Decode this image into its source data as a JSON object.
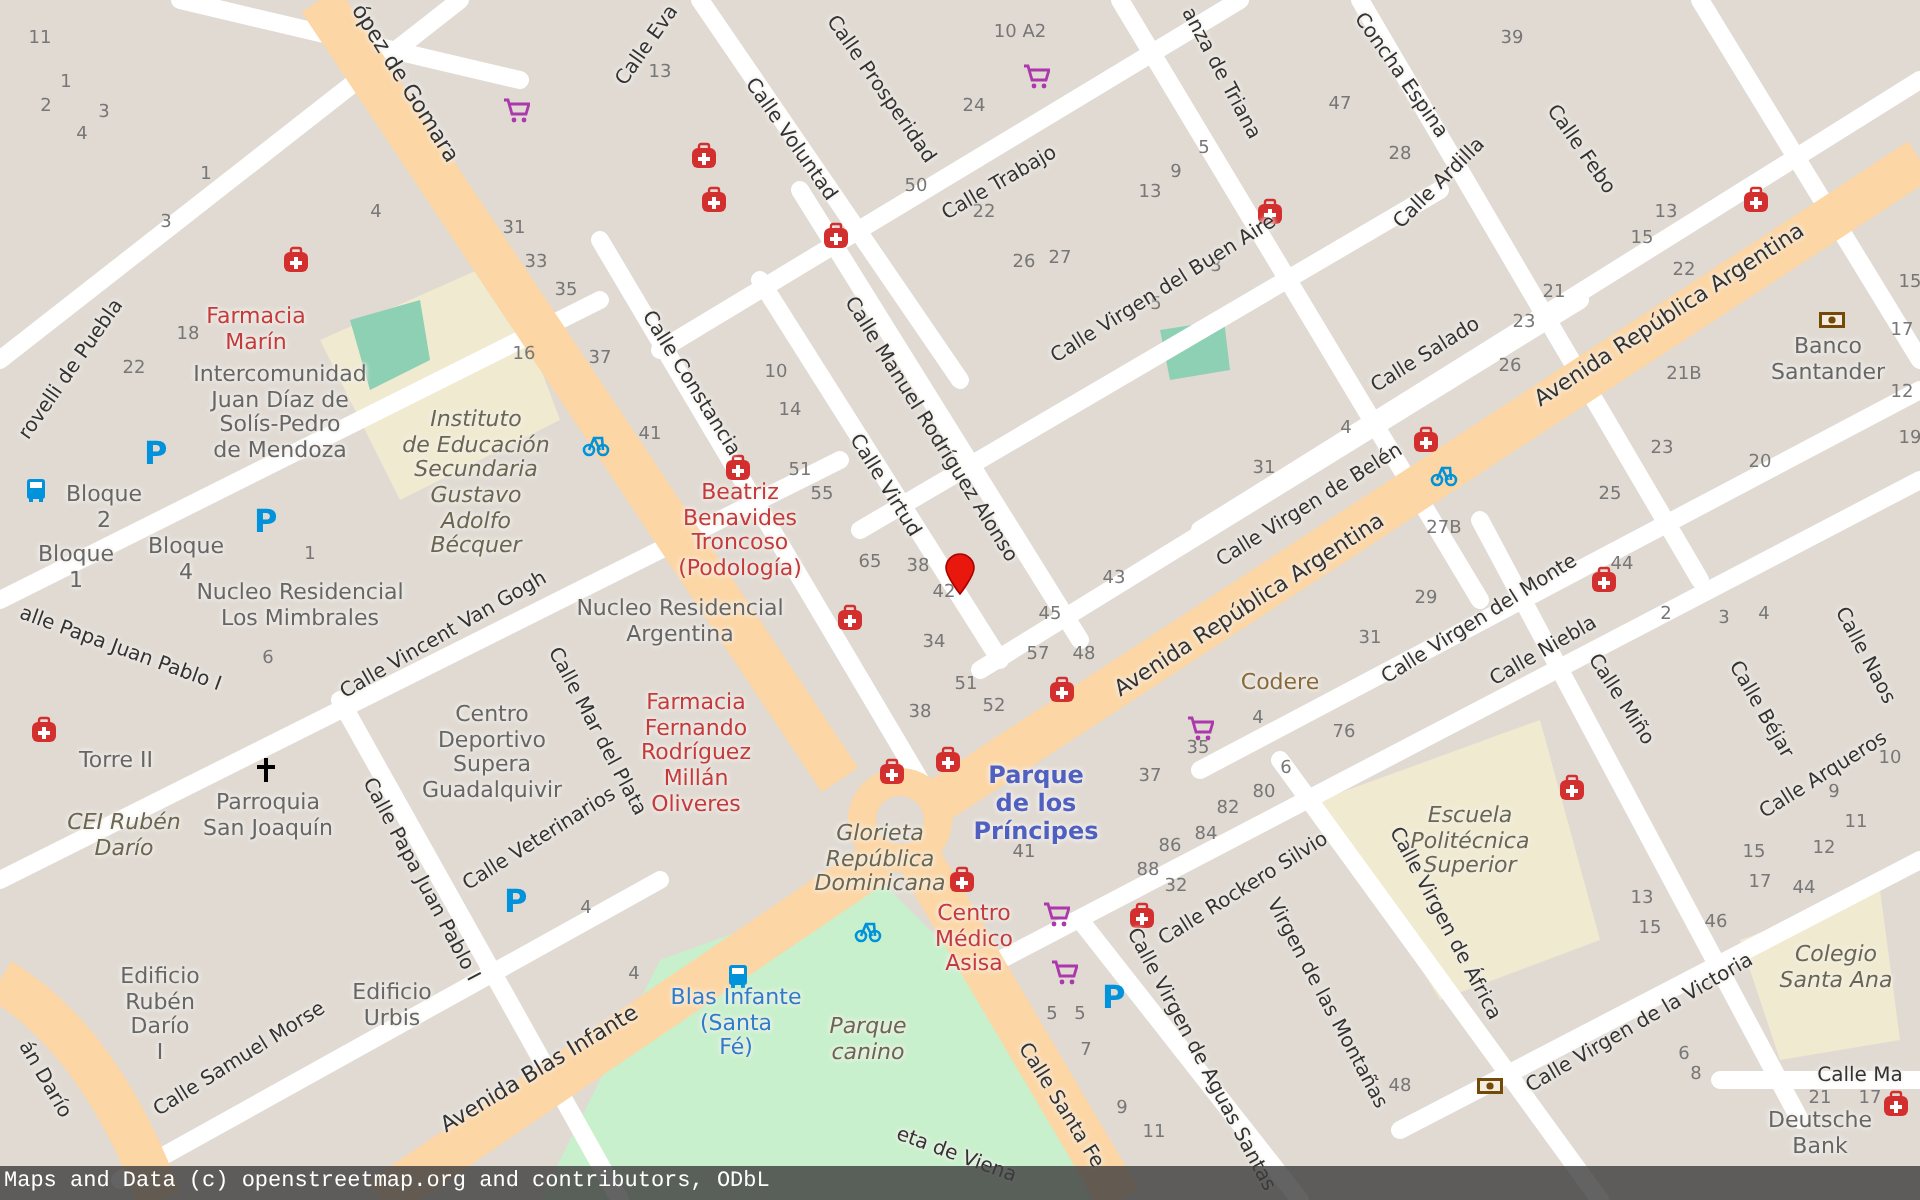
{
  "map": {
    "labels": [
      {
        "kind": "avenue",
        "lines": [
          "ópez de Gomara"
        ]
      },
      {
        "kind": "avenue",
        "lines": [
          "Avenida República Argentina"
        ]
      },
      {
        "kind": "avenue",
        "lines": [
          "Avenida República Argentina"
        ]
      },
      {
        "kind": "avenue",
        "lines": [
          "Avenida Blas Infante"
        ]
      },
      {
        "kind": "street",
        "lines": [
          "Calle Eva"
        ]
      },
      {
        "kind": "street",
        "lines": [
          "Calle Prosperidad"
        ]
      },
      {
        "kind": "street",
        "lines": [
          "Calle Voluntad"
        ]
      },
      {
        "kind": "street",
        "lines": [
          "Calle Trabajo"
        ]
      },
      {
        "kind": "street",
        "lines": [
          "anza de Triana"
        ]
      },
      {
        "kind": "street",
        "lines": [
          "Concha Espina"
        ]
      },
      {
        "kind": "street",
        "lines": [
          "Calle Ardilla"
        ]
      },
      {
        "kind": "street",
        "lines": [
          "Calle Febo"
        ]
      },
      {
        "kind": "street",
        "lines": [
          "Calle Virgen del Buen Aire"
        ]
      },
      {
        "kind": "street",
        "lines": [
          "Calle Salado"
        ]
      },
      {
        "kind": "street",
        "lines": [
          "Calle Manuel Rodríguez Alonso"
        ]
      },
      {
        "kind": "street",
        "lines": [
          "Calle Virtud"
        ]
      },
      {
        "kind": "street",
        "lines": [
          "Calle Constancia"
        ]
      },
      {
        "kind": "street",
        "lines": [
          "Calle Virgen de Belén"
        ]
      },
      {
        "kind": "street",
        "lines": [
          "rovelli de Puebla"
        ]
      },
      {
        "kind": "street",
        "lines": [
          "alle Papa Juan Pablo I"
        ]
      },
      {
        "kind": "street",
        "lines": [
          "Calle Vincent Van Gogh"
        ]
      },
      {
        "kind": "street",
        "lines": [
          "Calle Mar del Plata"
        ]
      },
      {
        "kind": "street",
        "lines": [
          "Calle Veterinarios"
        ]
      },
      {
        "kind": "street",
        "lines": [
          "Calle Papa Juan Pablo I"
        ]
      },
      {
        "kind": "street",
        "lines": [
          "Calle Samuel Morse"
        ]
      },
      {
        "kind": "street",
        "lines": [
          "án Darío"
        ]
      },
      {
        "kind": "street",
        "lines": [
          "Calle Virgen del Monte"
        ]
      },
      {
        "kind": "street",
        "lines": [
          "Calle Niebla"
        ]
      },
      {
        "kind": "street",
        "lines": [
          "Calle Miño"
        ]
      },
      {
        "kind": "street",
        "lines": [
          "Calle Béjar"
        ]
      },
      {
        "kind": "street",
        "lines": [
          "Calle Naos"
        ]
      },
      {
        "kind": "street",
        "lines": [
          "Calle Arqueros"
        ]
      },
      {
        "kind": "street",
        "lines": [
          "Calle Rockero Silvio"
        ]
      },
      {
        "kind": "street",
        "lines": [
          "Calle Virgen de África"
        ]
      },
      {
        "kind": "street",
        "lines": [
          "Virgen de las Montañas"
        ]
      },
      {
        "kind": "street",
        "lines": [
          "Calle Virgen de Aguas Santas"
        ]
      },
      {
        "kind": "street",
        "lines": [
          "Calle Virgen de la Victoria"
        ]
      },
      {
        "kind": "street",
        "lines": [
          "Calle Ma"
        ]
      },
      {
        "kind": "street",
        "lines": [
          "Calle Santa Fe"
        ]
      },
      {
        "kind": "street",
        "lines": [
          "eta de Viena"
        ]
      },
      {
        "kind": "health",
        "lines": [
          "Farmacia",
          "Marín"
        ]
      },
      {
        "kind": "place",
        "lines": [
          "Intercomunidad",
          "Juan Díaz de",
          "Solís-Pedro",
          "de Mendoza"
        ]
      },
      {
        "kind": "place",
        "lines": [
          "Bloque",
          "2"
        ]
      },
      {
        "kind": "place",
        "lines": [
          "Bloque",
          "1"
        ]
      },
      {
        "kind": "place",
        "lines": [
          "Bloque",
          "4"
        ]
      },
      {
        "kind": "amenity",
        "lines": [
          "Instituto",
          "de Educación",
          "Secundaria",
          "Gustavo",
          "Adolfo",
          "Bécquer"
        ]
      },
      {
        "kind": "health",
        "lines": [
          "Beatriz",
          "Benavides",
          "Troncoso",
          "(Podología)"
        ]
      },
      {
        "kind": "place",
        "lines": [
          "Nucleo Residencial",
          "Los Mimbrales"
        ]
      },
      {
        "kind": "place",
        "lines": [
          "Nucleo Residencial",
          "Argentina"
        ]
      },
      {
        "kind": "place",
        "lines": [
          "Torre II"
        ]
      },
      {
        "kind": "amenity",
        "lines": [
          "CEI Rubén",
          "Darío"
        ]
      },
      {
        "kind": "place",
        "lines": [
          "Parroquia",
          "San Joaquín"
        ]
      },
      {
        "kind": "place",
        "lines": [
          "Centro",
          "Deportivo",
          "Supera",
          "Guadalquivir"
        ]
      },
      {
        "kind": "health",
        "lines": [
          "Farmacia",
          "Fernando",
          "Rodríguez",
          "Millán",
          "Oliveres"
        ]
      },
      {
        "kind": "amenity",
        "lines": [
          "Glorieta",
          "República",
          "Dominicana"
        ]
      },
      {
        "kind": "health",
        "lines": [
          "Centro",
          "Médico",
          "Asisa"
        ]
      },
      {
        "kind": "park",
        "lines": [
          "Parque",
          "de los",
          "Príncipes"
        ]
      },
      {
        "kind": "shop",
        "lines": [
          "Codere"
        ]
      },
      {
        "kind": "place",
        "lines": [
          "Banco",
          "Santander"
        ]
      },
      {
        "kind": "amenity",
        "lines": [
          "Escuela",
          "Politécnica",
          "Superior"
        ]
      },
      {
        "kind": "amenity",
        "lines": [
          "Colegio",
          "Santa Ana"
        ]
      },
      {
        "kind": "place",
        "lines": [
          "Edificio",
          "Rubén",
          "Darío",
          "I"
        ]
      },
      {
        "kind": "place",
        "lines": [
          "Edificio",
          "Urbis"
        ]
      },
      {
        "kind": "transit",
        "lines": [
          "Blas Infante",
          "(Santa",
          "Fé)"
        ]
      },
      {
        "kind": "amenity",
        "lines": [
          "Parque",
          "canino"
        ]
      },
      {
        "kind": "place",
        "lines": [
          "Deutsche",
          "Bank"
        ]
      }
    ],
    "house_numbers": [
      "11",
      "1",
      "2",
      "3",
      "4",
      "1",
      "3",
      "4",
      "18",
      "22",
      "31",
      "33",
      "35",
      "16",
      "37",
      "41",
      "13",
      "50",
      "24",
      "10 A2",
      "22",
      "26",
      "27",
      "13",
      "9",
      "5",
      "3",
      "5",
      "47",
      "28",
      "39",
      "13",
      "15",
      "22",
      "21",
      "23",
      "26",
      "21B",
      "15",
      "17",
      "12",
      "19",
      "31",
      "4",
      "23",
      "20",
      "25",
      "27B",
      "43",
      "10",
      "14",
      "51",
      "55",
      "65",
      "38",
      "42",
      "34",
      "51",
      "52",
      "45",
      "57",
      "48",
      "38",
      "4",
      "35",
      "37",
      "6",
      "80",
      "82",
      "84",
      "86",
      "88",
      "32",
      "41",
      "76",
      "29",
      "31",
      "44",
      "2",
      "3",
      "4",
      "10",
      "9",
      "11",
      "15",
      "12",
      "17",
      "44",
      "13",
      "15",
      "46",
      "6",
      "8",
      "21",
      "17",
      "48",
      "9",
      "11",
      "5",
      "5",
      "7",
      "4",
      "4",
      "6",
      "1"
    ],
    "parking_signs": [
      "P",
      "P",
      "P",
      "P"
    ]
  },
  "attribution": "Maps and Data (c) openstreetmap.org and contributors, ODbL"
}
